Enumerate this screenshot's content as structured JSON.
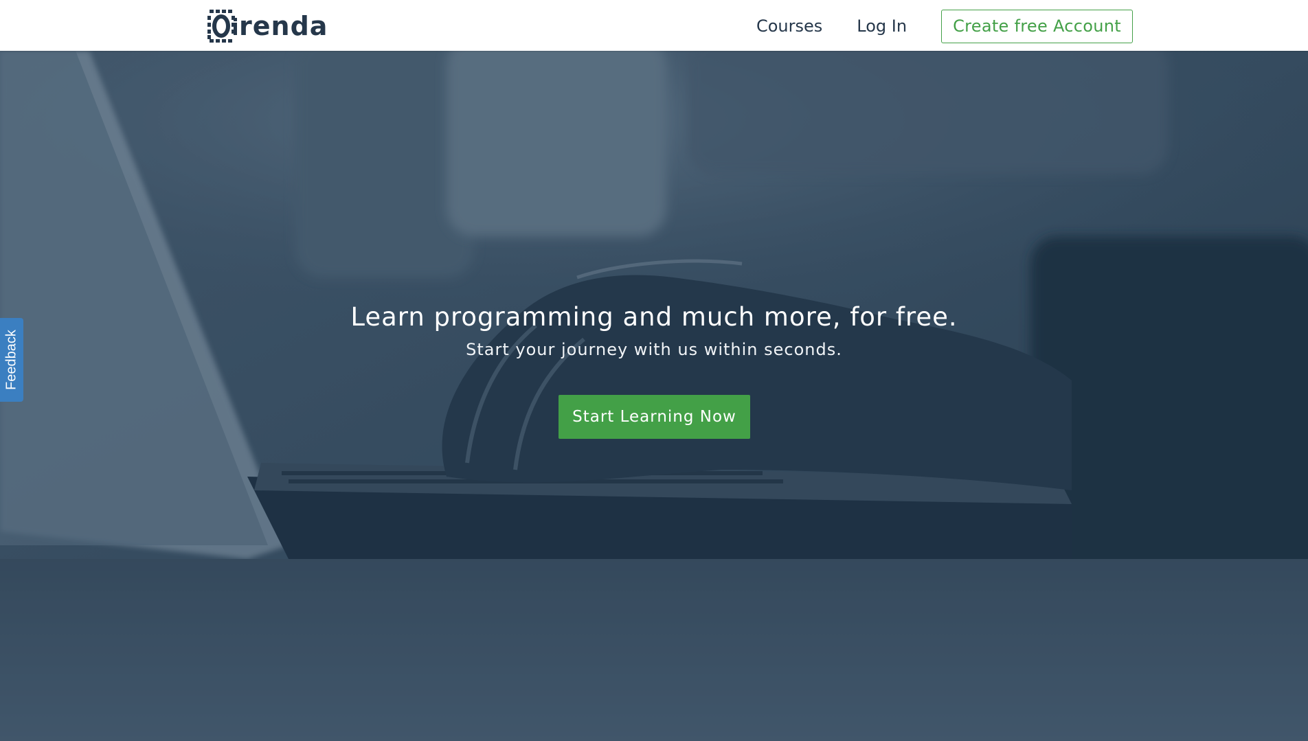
{
  "header": {
    "logo_text": "renda",
    "logo_alt": "Oirenda",
    "nav": {
      "courses": "Courses",
      "login": "Log In",
      "create_account": "Create free Account"
    }
  },
  "hero": {
    "title": "Learn programming and much more, for free.",
    "subtitle": "Start your journey with us within seconds.",
    "cta": "Start Learning Now"
  },
  "feedback_tab": {
    "label": "Feedback"
  },
  "colors": {
    "brand_dark": "#25374a",
    "accent_green": "#43a047",
    "feedback_blue": "#3b7fc1",
    "hero_overlay": "#2b3f52"
  }
}
